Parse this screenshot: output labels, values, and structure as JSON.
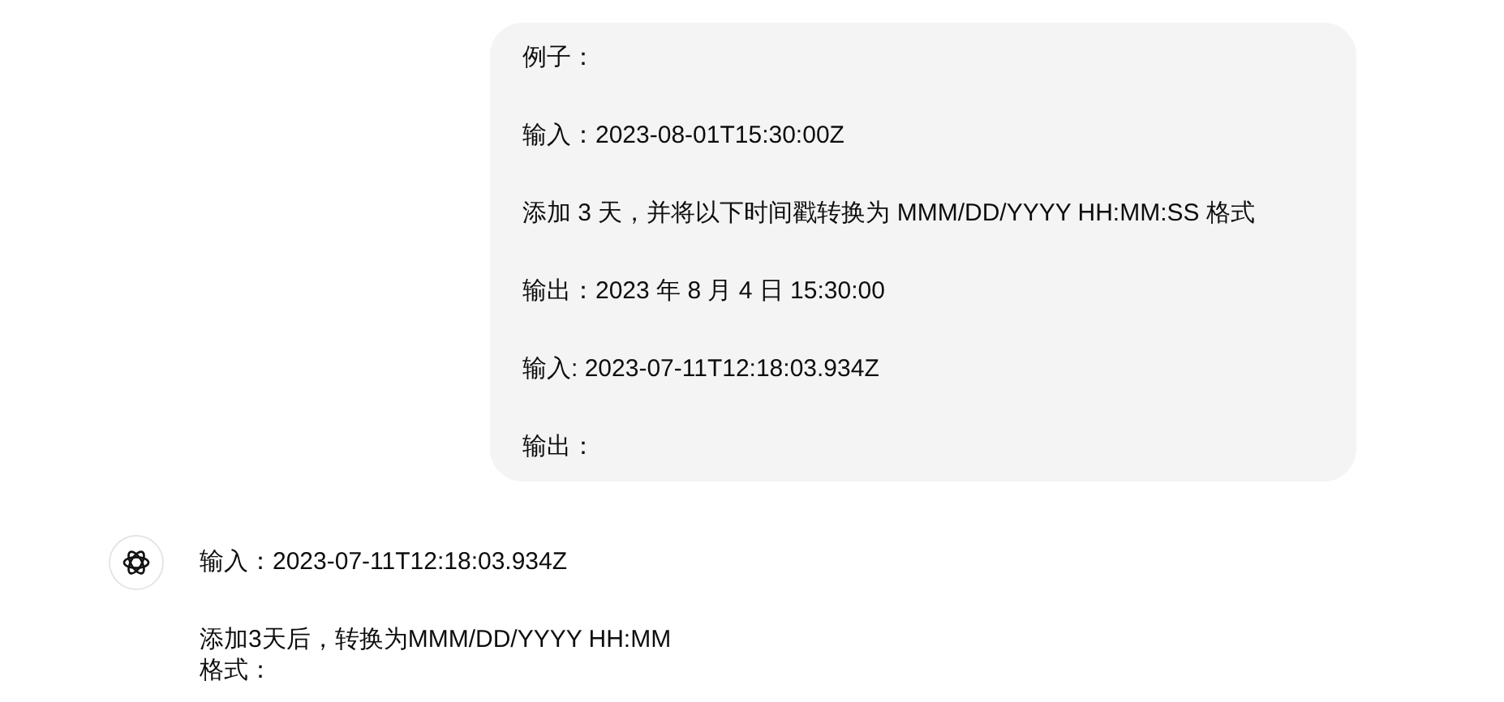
{
  "messages": [
    {
      "kind": "user",
      "paragraphs": [
        "例子：",
        "输入：2023-08-01T15:30:00Z",
        "添加 3 天，并将以下时间戳转换为 MMM/DD/YYYY HH:MM:SS 格式",
        "输出：2023 年 8 月 4 日 15:30:00",
        "输入: 2023-07-11T12:18:03.934Z",
        "输出："
      ]
    },
    {
      "kind": "assistant",
      "paragraphs": [
        "输入：2023-07-11T12:18:03.934Z",
        "添加3天后，转换为MMM/DD/YYYY HH:MM 格式："
      ]
    }
  ]
}
